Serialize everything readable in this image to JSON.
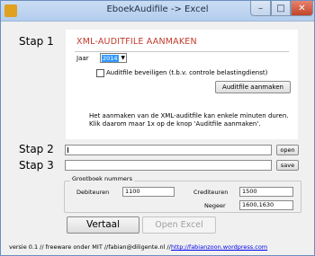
{
  "window": {
    "title": "EboekAudifile -> Excel",
    "controls": {
      "minimize": "–",
      "maximize": "□",
      "close": "✕"
    }
  },
  "steps": {
    "step1": "Stap 1",
    "step2": "Stap 2",
    "step3": "Stap 3"
  },
  "xml_panel": {
    "title": "XML-AUDITFILE AANMAKEN",
    "year_label": "Jaar",
    "year_value": "2014",
    "secure_checkbox_label": "Auditfile beveiligen (t.b.v. controle belastingdienst)",
    "secure_checked": false,
    "create_button": "Auditfile aanmaken",
    "note_line1": "Het aanmaken van de XML-auditfile kan enkele minuten duren.",
    "note_line2": "Klik daarom maar 1x op de knop 'Auditfile aanmaken'."
  },
  "open_row": {
    "value": "",
    "button": "open"
  },
  "save_row": {
    "value": "",
    "button": "save"
  },
  "grootboek": {
    "title": "Grootboek nummers",
    "debiteuren_label": "Debiteuren",
    "debiteuren_value": "1100",
    "crediteuren_label": "Crediteuren",
    "crediteuren_value": "1500",
    "negeer_label": "Negeer",
    "negeer_value": "1600,1630"
  },
  "actions": {
    "vertaal": "Vertaal",
    "open_excel": "Open Excel"
  },
  "footer": {
    "credits": "versie 0.1 // freeware onder MIT  //fabian@diligente.nl //",
    "link": "http://fabianzoon.wordpress.com"
  },
  "colors": {
    "panel_title": "#c0392b",
    "link": "#0000ee",
    "selection": "#3399ff",
    "disabled_text": "#a0a0a0"
  }
}
